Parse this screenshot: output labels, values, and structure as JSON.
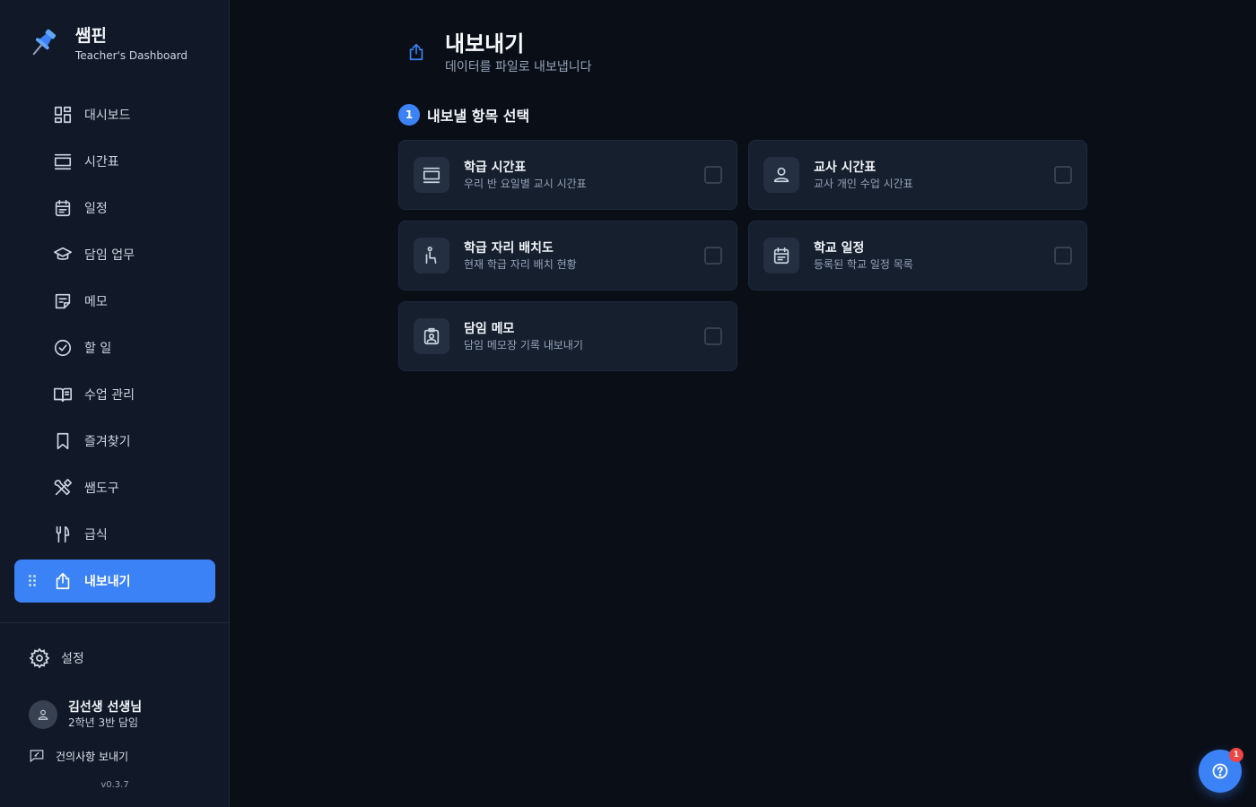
{
  "app": {
    "name": "쌤핀",
    "subtitle": "Teacher's Dashboard",
    "version": "v0.3.7"
  },
  "sidebar": {
    "items": [
      {
        "label": "대시보드",
        "icon": "dashboard-icon"
      },
      {
        "label": "시간표",
        "icon": "timetable-icon"
      },
      {
        "label": "일정",
        "icon": "calendar-icon"
      },
      {
        "label": "담임 업무",
        "icon": "graduation-cap-icon"
      },
      {
        "label": "메모",
        "icon": "note-icon"
      },
      {
        "label": "할 일",
        "icon": "check-circle-icon"
      },
      {
        "label": "수업 관리",
        "icon": "book-icon"
      },
      {
        "label": "즐겨찾기",
        "icon": "bookmark-icon"
      },
      {
        "label": "쌤도구",
        "icon": "tools-icon"
      },
      {
        "label": "급식",
        "icon": "utensils-icon"
      },
      {
        "label": "내보내기",
        "icon": "share-icon",
        "active": true
      }
    ],
    "settings_label": "설정",
    "user": {
      "name": "김선생 선생님",
      "role": "2학년 3반 담임"
    },
    "feedback_label": "건의사항 보내기"
  },
  "header": {
    "title": "내보내기",
    "subtitle": "데이터를 파일로 내보냅니다"
  },
  "step": {
    "number": "1",
    "title": "내보낼 항목 선택"
  },
  "export_items": [
    {
      "title": "학급 시간표",
      "desc": "우리 반 요일별 교시 시간표",
      "icon": "timetable-icon",
      "checked": false
    },
    {
      "title": "교사 시간표",
      "desc": "교사 개인 수업 시간표",
      "icon": "person-icon",
      "checked": false
    },
    {
      "title": "학급 자리 배치도",
      "desc": "현재 학급 자리 배치 현황",
      "icon": "seat-icon",
      "checked": false
    },
    {
      "title": "학교 일정",
      "desc": "등록된 학교 일정 목록",
      "icon": "calendar-icon",
      "checked": false
    },
    {
      "title": "담임 메모",
      "desc": "담임 메모장 기록 내보내기",
      "icon": "contact-card-icon",
      "checked": false
    }
  ],
  "help": {
    "badge": "1"
  },
  "colors": {
    "accent": "#3b82f6",
    "background": "#0a0e17",
    "sidebar": "#111827",
    "card": "#161f2e",
    "badge": "#ef4444"
  }
}
